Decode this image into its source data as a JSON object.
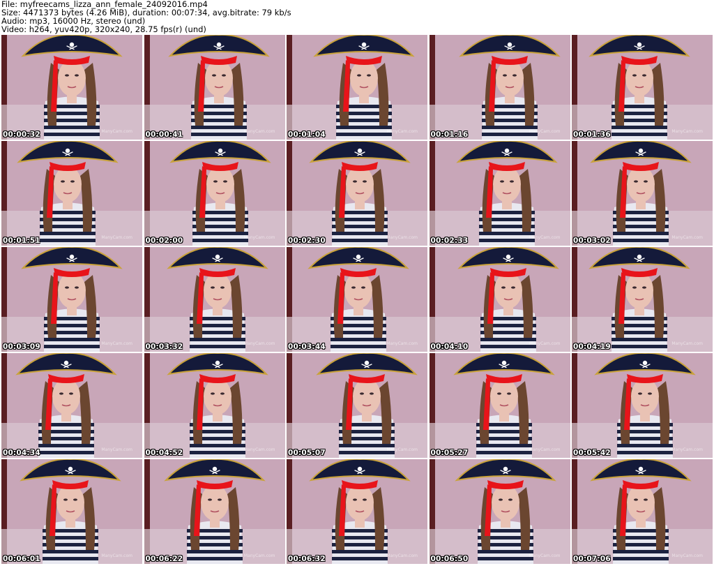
{
  "header": {
    "file_line": "File: myfreecams_lizza_ann_female_24092016.mp4",
    "size_line": "Size: 4471373 bytes (4.26 MiB), duration: 00:07:34, avg.bitrate: 79 kb/s",
    "audio_line": "Audio: mp3, 16000 Hz, stereo (und)",
    "video_line": "Video: h264, yuv420p, 320x240, 28.75 fps(r) (und)"
  },
  "watermark": "ManyCam.com",
  "colors": {
    "wall": "#c8a6b8",
    "hat": "#141a3a",
    "hat_trim": "#c9a23a",
    "bandana": "#e8141a",
    "hair": "#6b4630",
    "skin": "#e9c2b4",
    "stripe_dark": "#1c2240",
    "stripe_light": "#e8e8f0",
    "pillow": "#d8c8d2"
  },
  "frames": [
    {
      "time": "00:00:32"
    },
    {
      "time": "00:00:41"
    },
    {
      "time": "00:01:04"
    },
    {
      "time": "00:01:16"
    },
    {
      "time": "00:01:36"
    },
    {
      "time": "00:01:51"
    },
    {
      "time": "00:02:00"
    },
    {
      "time": "00:02:30"
    },
    {
      "time": "00:02:33"
    },
    {
      "time": "00:03:02"
    },
    {
      "time": "00:03:09"
    },
    {
      "time": "00:03:32"
    },
    {
      "time": "00:03:44"
    },
    {
      "time": "00:04:10"
    },
    {
      "time": "00:04:19"
    },
    {
      "time": "00:04:34"
    },
    {
      "time": "00:04:52"
    },
    {
      "time": "00:05:07"
    },
    {
      "time": "00:05:27"
    },
    {
      "time": "00:05:42"
    },
    {
      "time": "00:06:01"
    },
    {
      "time": "00:06:22"
    },
    {
      "time": "00:06:32"
    },
    {
      "time": "00:06:50"
    },
    {
      "time": "00:07:06"
    }
  ]
}
